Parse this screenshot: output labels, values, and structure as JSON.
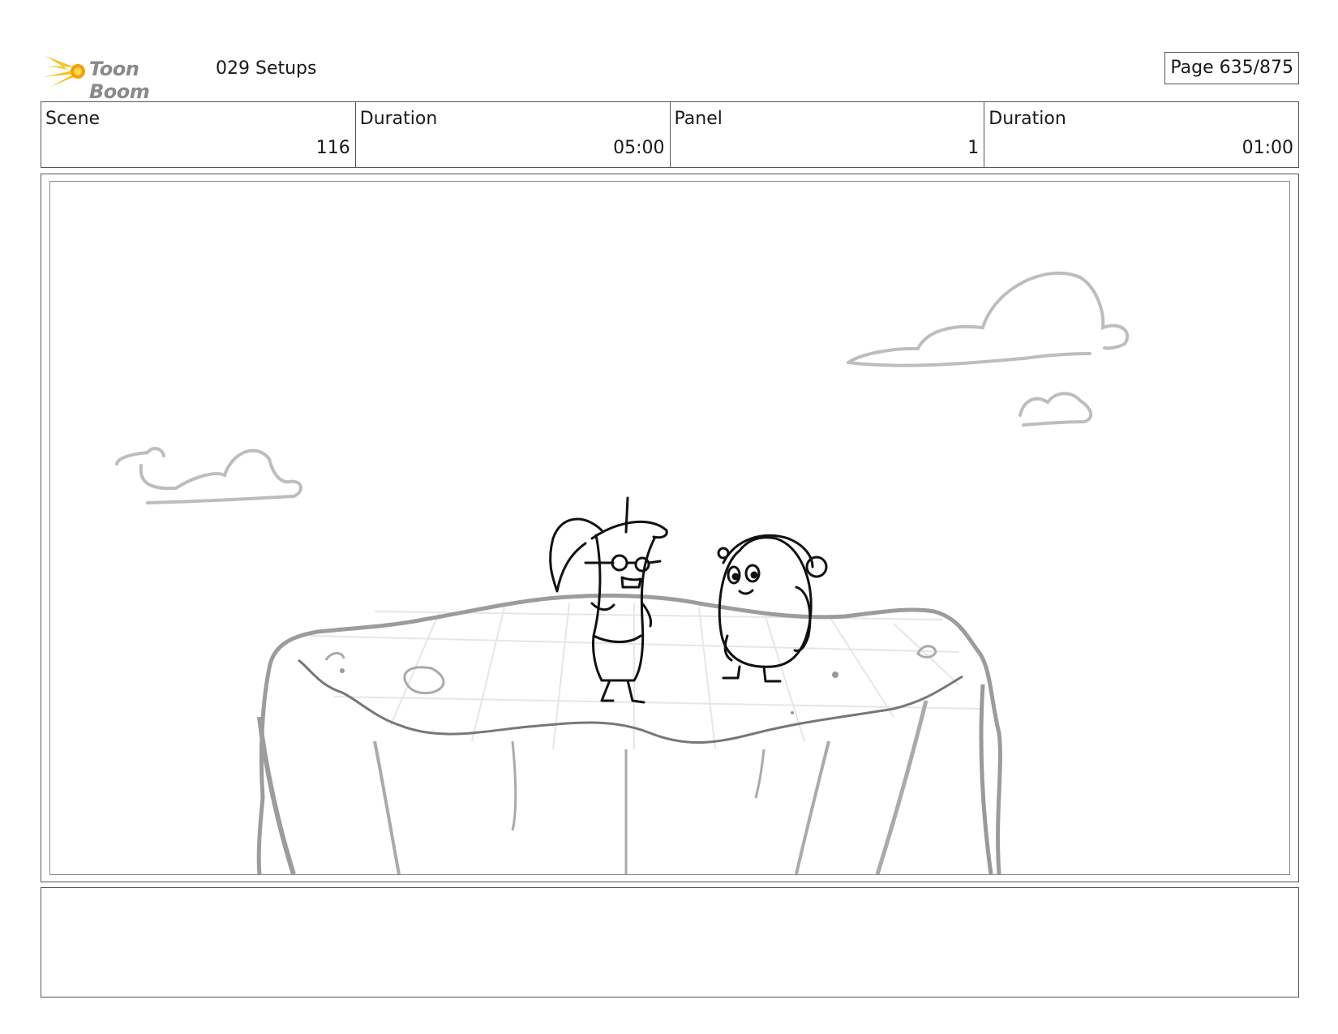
{
  "header": {
    "logo_text": "Toon Boom",
    "logo_icon": "toon-boom-logo-icon",
    "title": "029 Setups",
    "page": "Page 635/875"
  },
  "info": [
    {
      "label": "Scene",
      "value": "116"
    },
    {
      "label": "Duration",
      "value": "05:00"
    },
    {
      "label": "Panel",
      "value": "1"
    },
    {
      "label": "Duration",
      "value": "01:00"
    }
  ],
  "panel": {
    "description_icons": [
      "cloud-icon",
      "cliff-icon",
      "tall-character-icon",
      "round-character-icon"
    ]
  },
  "notes": {
    "text": ""
  }
}
